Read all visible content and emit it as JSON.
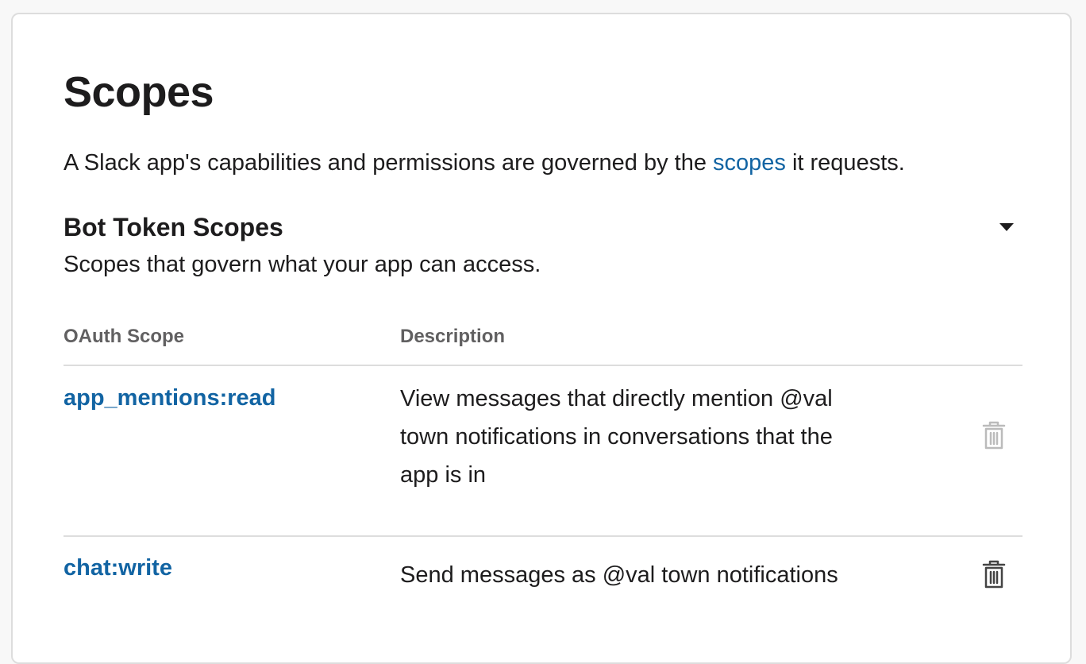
{
  "header": {
    "title": "Scopes",
    "intro_before": "A Slack app's capabilities and permissions are governed by the ",
    "intro_link": "scopes",
    "intro_after": " it requests."
  },
  "section": {
    "title": "Bot Token Scopes",
    "subtitle": "Scopes that govern what your app can access.",
    "toggle_icon": "caret-down-icon"
  },
  "table": {
    "columns": [
      "OAuth Scope",
      "Description"
    ],
    "rows": [
      {
        "scope": "app_mentions:read",
        "description": "View messages that directly mention @val town notifications in conversations that the app is in",
        "delete_icon": "trash-icon",
        "delete_enabled": false
      },
      {
        "scope": "chat:write",
        "description": "Send messages as @val town notifications",
        "delete_icon": "trash-icon",
        "delete_enabled": true
      }
    ]
  },
  "colors": {
    "link": "#1264a3",
    "text": "#1d1c1d",
    "muted": "#616061",
    "divider": "#dddddd",
    "icon_disabled": "#bbbbbb",
    "icon_enabled": "#444444"
  }
}
